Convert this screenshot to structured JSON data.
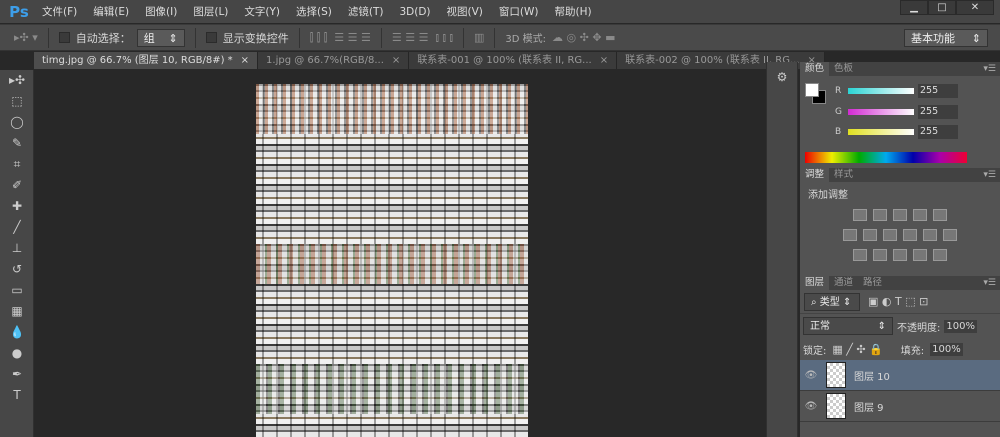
{
  "app": {
    "logo": "Ps"
  },
  "menu": [
    "文件(F)",
    "编辑(E)",
    "图像(I)",
    "图层(L)",
    "文字(Y)",
    "选择(S)",
    "滤镜(T)",
    "3D(D)",
    "视图(V)",
    "窗口(W)",
    "帮助(H)"
  ],
  "window_controls": {
    "minimize": "▁",
    "maximize": "□",
    "close": "✕"
  },
  "options": {
    "auto_select_label": "自动选择：",
    "auto_select_value": "组",
    "show_transform_label": "显示变换控件",
    "mode_3d_label": "3D 模式:",
    "workspace": "基本功能"
  },
  "tabs": [
    {
      "label": "timg.jpg @ 66.7% (图层 10, RGB/8#) *",
      "active": true
    },
    {
      "label": "1.jpg @ 66.7%(RGB/8...",
      "active": false
    },
    {
      "label": "联系表-001 @ 100% (联系表 II, RG...",
      "active": false
    },
    {
      "label": "联系表-002 @ 100% (联系表 II, RG...",
      "active": false
    }
  ],
  "tab_close": "×",
  "tools": [
    "move",
    "marquee",
    "lasso",
    "quick-select",
    "crop",
    "eyedropper",
    "healing",
    "brush",
    "stamp",
    "history-brush",
    "eraser",
    "gradient",
    "blur",
    "dodge",
    "pen",
    "type"
  ],
  "tool_glyphs": [
    "▸✣",
    "⬚",
    "◯",
    "✎",
    "⌗",
    "✐",
    "✚",
    "╱",
    "⊥",
    "↺",
    "▭",
    "▦",
    "💧",
    "●",
    "✒",
    "T"
  ],
  "color_panel": {
    "tabs": [
      "颜色",
      "色板"
    ],
    "r_label": "R",
    "g_label": "G",
    "b_label": "B",
    "r": "255",
    "g": "255",
    "b": "255"
  },
  "adjust_panel": {
    "tabs": [
      "调整",
      "样式"
    ],
    "title": "添加调整"
  },
  "layers_panel": {
    "tabs": [
      "图层",
      "通道",
      "路径"
    ],
    "filter": "类型",
    "blend_mode": "正常",
    "opacity_label": "不透明度:",
    "opacity": "100%",
    "lock_label": "锁定:",
    "fill_label": "填充:",
    "fill": "100%",
    "layers": [
      {
        "name": "图层 10",
        "selected": true
      },
      {
        "name": "图层 9",
        "selected": false
      }
    ]
  }
}
